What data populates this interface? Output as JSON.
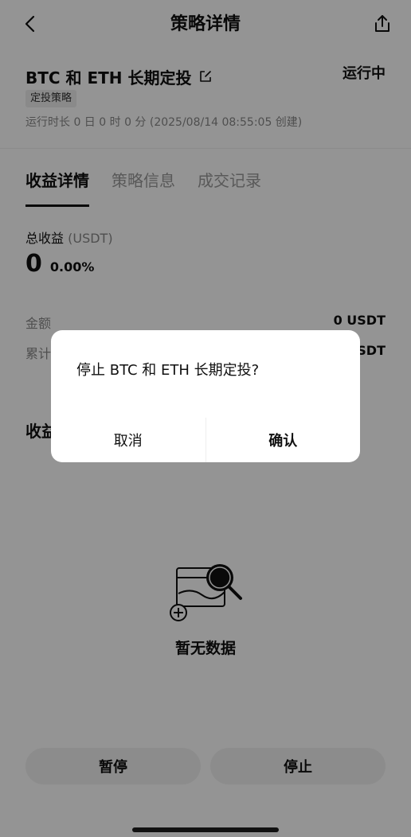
{
  "header": {
    "title": "策略详情",
    "back_icon": "chevron-left-icon",
    "share_icon": "share-icon"
  },
  "strategy": {
    "name": "BTC 和 ETH 长期定投",
    "status": "运行中",
    "tag": "定投策略",
    "runtime": "运行时长 0 日 0 时 0 分 (2025/08/14 08:55:05 创建)"
  },
  "tabs": [
    {
      "label": "收益详情",
      "active": true
    },
    {
      "label": "策略信息",
      "active": false
    },
    {
      "label": "成交记录",
      "active": false
    }
  ],
  "profit": {
    "label": "总收益",
    "unit": "(USDT)",
    "value": "0",
    "percent": "0.00%"
  },
  "rows": [
    {
      "label": "金额",
      "value": "0 USDT"
    },
    {
      "label": "累计",
      "value": "0 USDT"
    }
  ],
  "section": {
    "heading": "收益"
  },
  "empty": {
    "text": "暂无数据"
  },
  "buttons": {
    "pause": "暂停",
    "stop": "停止"
  },
  "dialog": {
    "message": "停止 BTC 和 ETH 长期定投?",
    "cancel": "取消",
    "confirm": "确认"
  },
  "colors": {
    "text": "#111111",
    "muted": "#888888",
    "overlay": "rgba(0,0,0,0.42)",
    "button_bg": "#f2f2f2"
  }
}
